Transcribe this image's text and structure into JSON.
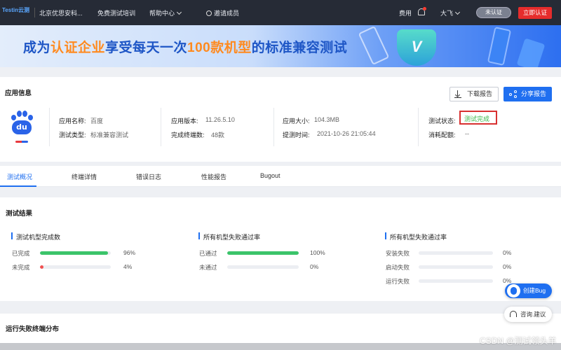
{
  "topbar": {
    "logo": "Testin云测",
    "company": "北京优思安科...",
    "training": "免费测试培训",
    "help": "帮助中心",
    "invite": "邀请成员",
    "billing": "费用",
    "user": "大飞",
    "unverified": "未认证",
    "verify_now": "立即认证"
  },
  "banner": {
    "text_1": "成为",
    "text_hl_1": "认证企业",
    "text_2": "享受每天一次",
    "text_hl_2": "100款机型",
    "text_3": "的标准兼容测试",
    "shield_letter": "V"
  },
  "app_info": {
    "title": "应用信息",
    "download_report": "下载报告",
    "share_report": "分享报告",
    "logo_text": "du",
    "name_label": "应用名称:",
    "name_value": "百度",
    "type_label": "测试类型:",
    "type_value": "标准兼容测试",
    "version_label": "应用版本:",
    "version_value": "11.26.5.10",
    "devices_label": "完成终端数:",
    "devices_value": "48款",
    "size_label": "应用大小:",
    "size_value": "104.3MB",
    "submit_label": "提测时间:",
    "submit_value": "2021-10-26 21:05:44",
    "status_label": "测试状态:",
    "status_value": "测试完成",
    "quota_label": "消耗配额:",
    "quota_value": "--"
  },
  "tabs": [
    "测试概况",
    "终端详情",
    "错误日志",
    "性能报告",
    "Bugout"
  ],
  "results": {
    "title": "测试结果",
    "groups": [
      {
        "title": "测试机型完成数",
        "rows": [
          {
            "label": "已完成",
            "percent": "96%",
            "fraction": 0.96,
            "color": "#3bc46a"
          },
          {
            "label": "未完成",
            "percent": "4%",
            "fraction": 0.04,
            "color": "#f05050"
          }
        ]
      },
      {
        "title": "所有机型失败通过率",
        "rows": [
          {
            "label": "已通过",
            "percent": "100%",
            "fraction": 1.0,
            "color": "#3bc46a"
          },
          {
            "label": "未通过",
            "percent": "0%",
            "fraction": 0,
            "color": "#f05050"
          }
        ]
      },
      {
        "title": "所有机型失败通过率",
        "rows": [
          {
            "label": "安装失败",
            "percent": "0%",
            "fraction": 0,
            "color": "#f05050"
          },
          {
            "label": "启动失败",
            "percent": "0%",
            "fraction": 0,
            "color": "#f05050"
          },
          {
            "label": "运行失败",
            "percent": "0%",
            "fraction": 0,
            "color": "#f05050"
          }
        ]
      }
    ]
  },
  "distribution": {
    "title": "运行失败终端分布"
  },
  "floating": {
    "create_bug": "创建Bug",
    "feedback": "咨询.建议"
  },
  "watermark": "CSDN @测试领头羊"
}
